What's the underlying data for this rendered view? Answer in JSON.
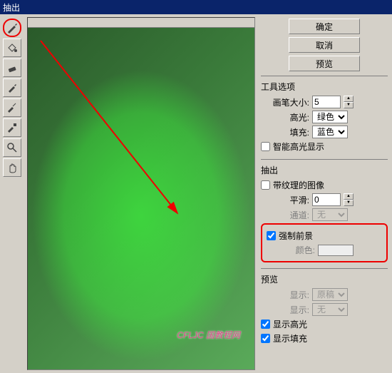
{
  "title": "抽出",
  "buttons": {
    "ok": "确定",
    "cancel": "取消",
    "preview": "预览"
  },
  "tool_options": {
    "title": "工具选项",
    "brush_size_label": "画笔大小:",
    "brush_size_value": "5",
    "highlight_label": "高光:",
    "highlight_value": "绿色",
    "fill_label": "填充:",
    "fill_value": "蓝色",
    "smart_highlight": "智能高光显示"
  },
  "extract": {
    "title": "抽出",
    "textured_image": "带纹理的图像",
    "smooth_label": "平滑:",
    "smooth_value": "0",
    "channel_label": "通道:",
    "channel_value": "无",
    "force_foreground": "强制前景",
    "color_label": "颜色:"
  },
  "preview_section": {
    "title": "预览",
    "show_label": "显示:",
    "show_value": "原稿",
    "display_label": "显示:",
    "display_value": "无",
    "show_highlight": "显示高光",
    "show_fill": "显示填充"
  },
  "watermark": "CFLJC 国教程网",
  "checked": {
    "smart_highlight": false,
    "textured_image": false,
    "force_foreground": true,
    "show_highlight": true,
    "show_fill": true
  },
  "colors": {
    "highlight": "#e00000",
    "green_overlay": "#40ff40"
  }
}
